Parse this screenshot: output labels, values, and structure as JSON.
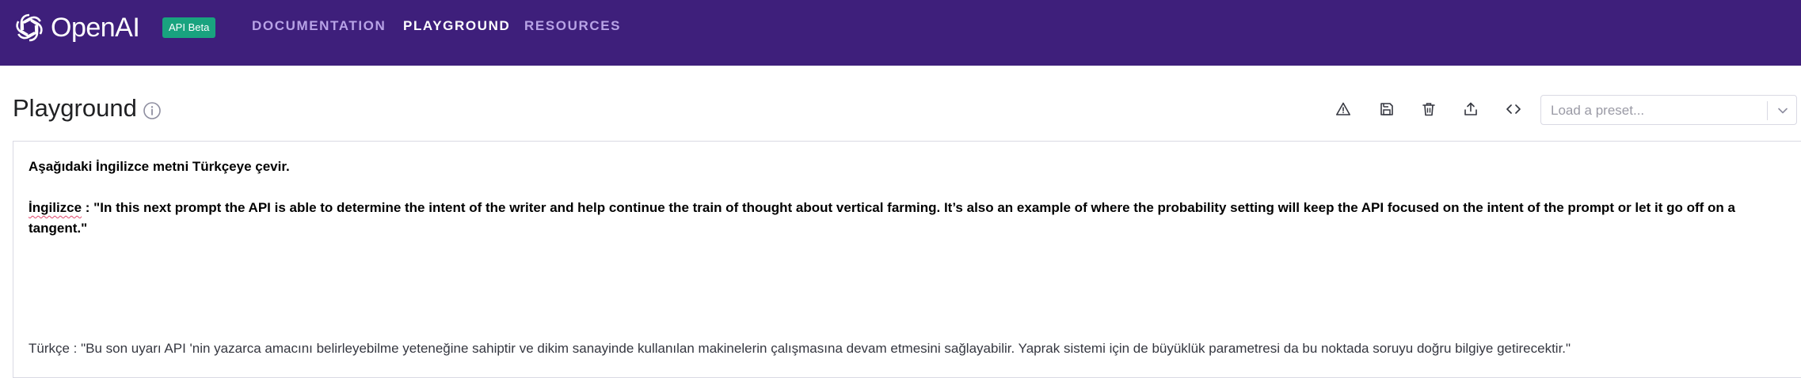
{
  "header": {
    "brand": "OpenAI",
    "badge": "API Beta",
    "nav": [
      {
        "label": "DOCUMENTATION",
        "active": false
      },
      {
        "label": "PLAYGROUND",
        "active": true
      },
      {
        "label": "RESOURCES",
        "active": false
      }
    ],
    "colors": {
      "background": "#3e1f7b",
      "badge": "#19a37f",
      "inactive_link": "#b8a3e6"
    }
  },
  "page": {
    "title": "Playground",
    "info_icon": "info-circle-icon"
  },
  "toolbar": {
    "icons": [
      "warning-icon",
      "save-icon",
      "trash-icon",
      "share-icon",
      "code-icon"
    ]
  },
  "preset": {
    "placeholder": "Load a preset...",
    "chevron_icon": "chevron-down-icon"
  },
  "editor": {
    "instruction": "Aşağıdaki İngilizce metni Türkçeye çevir.",
    "english_label": "İngilizce",
    "english_text": " : \"In this next prompt the API is able to determine the intent of the writer and help continue the train of thought about vertical farming. It’s also an example of where the probability setting will keep the API focused on the intent of the prompt or let it go off on a tangent.\"",
    "turkish_text": "Türkçe : \"Bu son uyarı API 'nin yazarca amacını belirleyebilme yeteneğine sahiptir ve dikim sanayinde kullanılan makinelerin çalışmasına devam etmesini sağlayabilir. Yaprak sistemi için de büyüklük parametresi da bu noktada soruyu doğru bilgiye getirecektir.\""
  }
}
